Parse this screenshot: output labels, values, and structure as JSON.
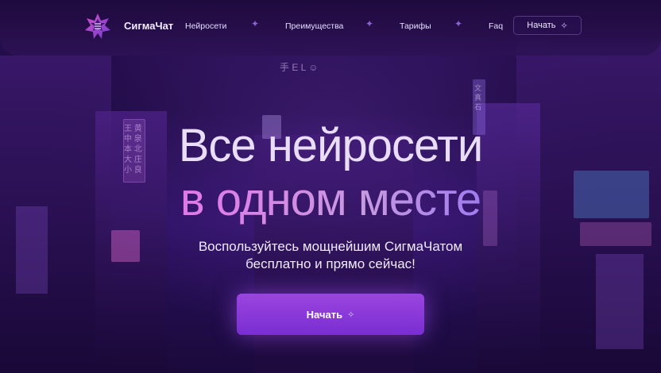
{
  "header": {
    "brand": "СигмаЧат",
    "nav": [
      "Нейросети",
      "Преимущества",
      "Тарифы",
      "Faq"
    ],
    "start_label": "Начать",
    "separator_glyph": "✦"
  },
  "hero": {
    "title_line1": "Все нейросети",
    "title_line2": "в одном месте",
    "subtitle_line1": "Воспользуйтесь мощнейшим СигмаЧатом",
    "subtitle_line2": "бесплатно и прямо сейчас!",
    "cta_label": "Начать"
  },
  "background_signs": {
    "top": "手 E L ☺",
    "left": "王 黄 中 泉 本 北 大 庄 小 良",
    "right": "文 真 石"
  },
  "colors": {
    "accent": "#8a3ad8",
    "gradient_start": "#d05cf0",
    "gradient_end": "#9a78ef",
    "background": "#1d0a40"
  },
  "icons": {
    "logo": "sigma-star-logo-icon",
    "sparkle": "sparkle-icon"
  }
}
